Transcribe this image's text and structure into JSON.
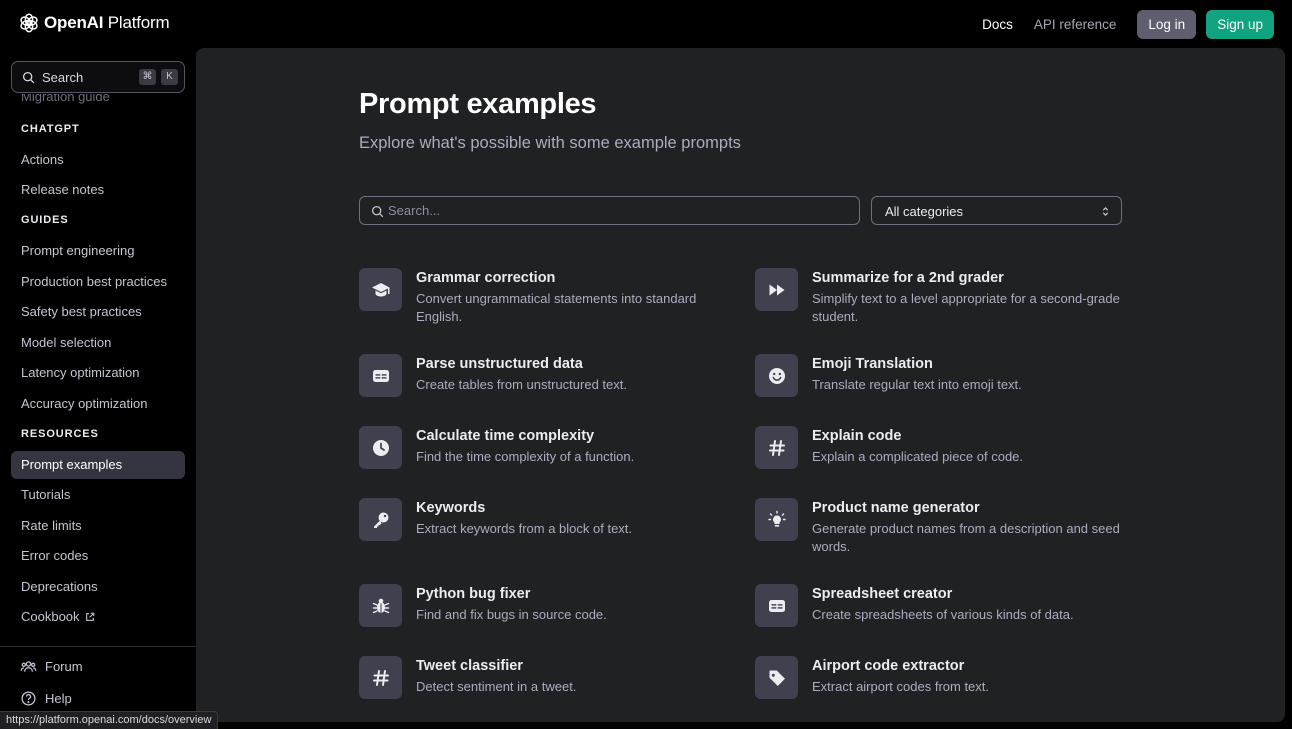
{
  "brand": {
    "name_bold": "OpenAI",
    "name_rest": " Platform"
  },
  "topnav": {
    "docs": "Docs",
    "api_reference": "API reference",
    "login": "Log in",
    "signup": "Sign up"
  },
  "sidebar": {
    "search_label": "Search",
    "shortcut_cmd": "⌘",
    "shortcut_key": "K",
    "items": [
      {
        "type": "item",
        "label": "Migration guide",
        "state": "faded"
      },
      {
        "type": "heading",
        "label": "CHATGPT"
      },
      {
        "type": "item",
        "label": "Actions"
      },
      {
        "type": "item",
        "label": "Release notes"
      },
      {
        "type": "heading",
        "label": "GUIDES"
      },
      {
        "type": "item",
        "label": "Prompt engineering"
      },
      {
        "type": "item",
        "label": "Production best practices"
      },
      {
        "type": "item",
        "label": "Safety best practices"
      },
      {
        "type": "item",
        "label": "Model selection"
      },
      {
        "type": "item",
        "label": "Latency optimization"
      },
      {
        "type": "item",
        "label": "Accuracy optimization"
      },
      {
        "type": "heading",
        "label": "RESOURCES"
      },
      {
        "type": "item",
        "label": "Prompt examples",
        "state": "active"
      },
      {
        "type": "item",
        "label": "Tutorials"
      },
      {
        "type": "item",
        "label": "Rate limits"
      },
      {
        "type": "item",
        "label": "Error codes"
      },
      {
        "type": "item",
        "label": "Deprecations"
      },
      {
        "type": "item",
        "label": "Cookbook",
        "icon": "external-link-icon"
      }
    ],
    "forum": "Forum",
    "help": "Help"
  },
  "statusbar": {
    "url": "https://platform.openai.com/docs/overview"
  },
  "main": {
    "title": "Prompt examples",
    "subtitle": "Explore what's possible with some example prompts",
    "search_placeholder": "Search...",
    "category_value": "All categories",
    "examples": [
      {
        "title": "Grammar correction",
        "description": "Convert ungrammatical statements into standard English.",
        "icon": "graduation-cap-icon"
      },
      {
        "title": "Summarize for a 2nd grader",
        "description": "Simplify text to a level appropriate for a second-grade student.",
        "icon": "fast-forward-icon"
      },
      {
        "title": "Parse unstructured data",
        "description": "Create tables from unstructured text.",
        "icon": "table-icon"
      },
      {
        "title": "Emoji Translation",
        "description": "Translate regular text into emoji text.",
        "icon": "smiley-icon"
      },
      {
        "title": "Calculate time complexity",
        "description": "Find the time complexity of a function.",
        "icon": "clock-icon"
      },
      {
        "title": "Explain code",
        "description": "Explain a complicated piece of code.",
        "icon": "hashtag-icon"
      },
      {
        "title": "Keywords",
        "description": "Extract keywords from a block of text.",
        "icon": "key-icon"
      },
      {
        "title": "Product name generator",
        "description": "Generate product names from a description and seed words.",
        "icon": "lightbulb-icon"
      },
      {
        "title": "Python bug fixer",
        "description": "Find and fix bugs in source code.",
        "icon": "bug-icon"
      },
      {
        "title": "Spreadsheet creator",
        "description": "Create spreadsheets of various kinds of data.",
        "icon": "table-icon"
      },
      {
        "title": "Tweet classifier",
        "description": "Detect sentiment in a tweet.",
        "icon": "hashtag-icon"
      },
      {
        "title": "Airport code extractor",
        "description": "Extract airport codes from text.",
        "icon": "tag-icon"
      }
    ]
  }
}
